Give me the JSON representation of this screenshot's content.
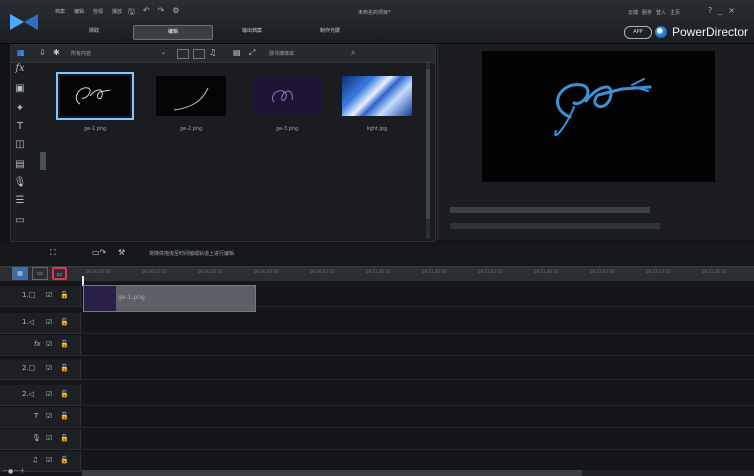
{
  "app": {
    "brand": "PowerDirector",
    "app_badge": "APP",
    "title_center": "未命名的项目*",
    "menus": [
      "档案",
      "编辑",
      "检视",
      "播放"
    ],
    "right_menus": [
      "云端",
      "服务",
      "登入",
      "主页"
    ],
    "tabs": [
      "撷取",
      "编辑",
      "输出档案",
      "制作光碟"
    ],
    "active_tab": "编辑"
  },
  "library": {
    "dropdown": "所有内容",
    "search_placeholder": "搜寻媒体库",
    "items": [
      {
        "label": "ge-1.png"
      },
      {
        "label": "ge-2.png"
      },
      {
        "label": "ge-3.png"
      },
      {
        "label": "light.jpg"
      }
    ]
  },
  "timeline": {
    "hint": "将媒体拖曳至时间轴或轨道上进行编辑",
    "ruler_ticks": [
      "00:00:00:00",
      "00:00:13:10",
      "00:00:26:20",
      "00:00:40:00",
      "00:00:53:10",
      "00:01:06:20",
      "00:01:20:00",
      "00:01:33:10",
      "00:01:46:20",
      "00:02:00:00",
      "00:02:13:10",
      "00:02:26:20"
    ],
    "clip_label": "ge-1.png",
    "tracks": [
      {
        "label": "1.□"
      },
      {
        "label": "1.◁"
      },
      {
        "label": "fx"
      },
      {
        "label": "2.□"
      },
      {
        "label": "2.◁"
      },
      {
        "label": "T"
      },
      {
        "label": "🎙"
      },
      {
        "label": "♫"
      }
    ]
  },
  "colors": {
    "highlight": "#e1364d",
    "selection": "#7fc7ff",
    "brand_blue": "#2a8cf0"
  }
}
